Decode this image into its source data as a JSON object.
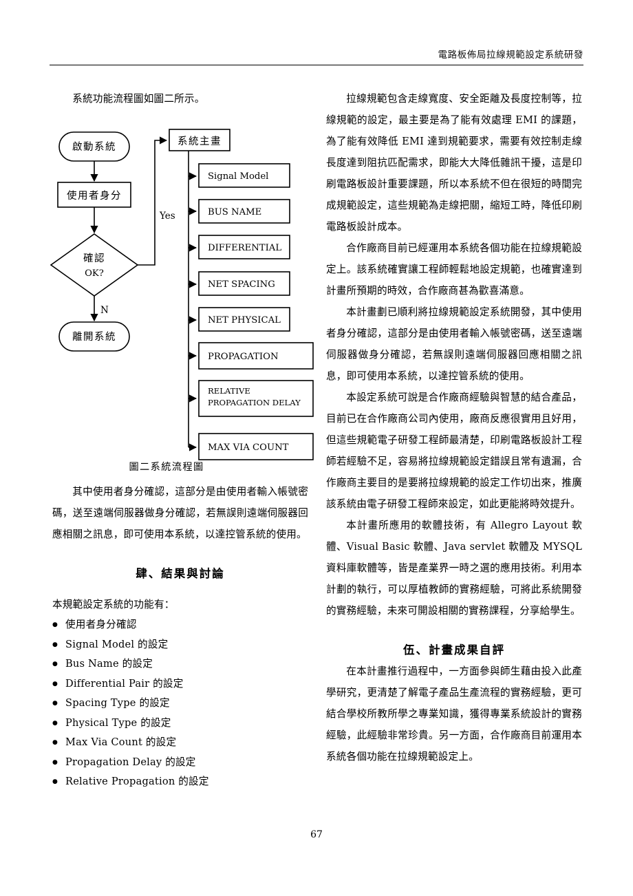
{
  "header": {
    "running_title": "電路板佈局拉線規範設定系統研發"
  },
  "left_column": {
    "intro_line": "系統功能流程圖如圖二所示。",
    "figure_caption": "圖二系統流程圖",
    "para_after_figure": "其中使用者身分確認，這部分是由使用者輸入帳號密碼，送至遠端伺服器做身分確認，若無誤則遠端伺服器回應相關之訊息，即可使用本系統，以達控管系統的使用。",
    "section_heading": "肆、結果與討論",
    "list_intro": "本規範設定系統的功能有：",
    "feature_list": [
      " 使用者身分確認",
      "Signal Model 的設定",
      "Bus Name 的設定",
      "Differential Pair 的設定",
      "Spacing Type 的設定",
      "Physical Type 的設定",
      "Max Via Count  的設定",
      "Propagation Delay 的設定",
      "Relative Propagation 的設定"
    ]
  },
  "right_column": {
    "para_1": "拉線規範包含走線寬度、安全距離及長度控制等，拉線規範的設定，最主要是為了能有效處理 EMI 的課題，為了能有效降低 EMI 達到規範要求，需要有效控制走線長度達到阻抗匹配需求，即能大大降低雜訊干擾，這是印刷電路板設計重要課題，所以本系統不但在很短的時間完成規範設定，這些規範為走線把關，縮短工時，降低印刷電路板設計成本。",
    "para_2": "合作廠商目前已經運用本系統各個功能在拉線規範設定上。該系統確實讓工程師輕鬆地設定規範，也確實達到計畫所預期的時效，合作廠商甚為歡喜滿意。",
    "para_3": "本計畫劃已順利將拉線規範設定系統開發，其中使用者身分確認，這部分是由使用者輸入帳號密碼，送至遠端伺服器做身分確認，若無誤則遠端伺服器回應相關之訊息，即可使用本系統，以達控管系統的使用。",
    "para_4": "本設定系統可說是合作廠商經驗與智慧的結合產品，目前已在合作廠商公司內使用，廠商反應很實用且好用，但這些規範電子研發工程師最清楚，印刷電路板設計工程師若經驗不足，容易將拉線規範設定錯誤且常有遺漏，合作廠商主要目的是要將拉線規範的設定工作切出來，推廣該系統由電子研發工程師來設定，如此更能將時效提升。",
    "para_5": "本計畫所應用的軟體技術，有 Allegro Layout 軟體、Visual Basic 軟體、Java servlet 軟體及 MYSQL 資料庫軟體等，皆是產業界一時之選的應用技術。利用本計劃的執行，可以厚植教師的實務經驗，可將此系統開發的實務經驗，未來可開設相關的實務課程，分享給學生。",
    "section_heading": "伍、計畫成果自評",
    "para_6": "在本計畫推行過程中，一方面參與師生藉由投入此產學研究，更清楚了解電子產品生產流程的實務經驗，更可結合學校所教所學之專業知識，獲得專業系統設計的實務經驗，此經驗非常珍貴。另一方面，合作廠商目前運用本系統各個功能在拉線規範設定上。"
  },
  "flowchart": {
    "start_node": "啟動系統",
    "user_identity_node": "使用者身分",
    "decision_node_line1": "確認",
    "decision_node_line2": "OK?",
    "branch_yes": "Yes",
    "branch_no": "N",
    "exit_node": "離開系統",
    "main_screen_node": "系統主畫",
    "modules": [
      "Signal Model",
      "BUS NAME",
      "DIFFERENTIAL",
      "NET SPACING",
      "NET PHYSICAL",
      "PROPAGATION",
      "RELATIVE",
      "PROPAGATION DELAY",
      "MAX VIA COUNT"
    ]
  },
  "footer": {
    "page_number": "67"
  }
}
